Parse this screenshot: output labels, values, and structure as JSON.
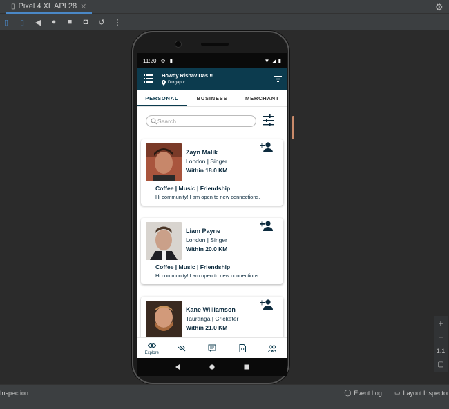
{
  "ide": {
    "device_tab": "Pixel 4 XL API 28",
    "close_glyph": "✕",
    "status_left": "Inspection",
    "status_right": [
      "Event Log",
      "Layout Inspector"
    ],
    "zoom": {
      "zoom_in": "+",
      "zoom_out": "−",
      "actual_size": "1:1"
    }
  },
  "phone": {
    "status": {
      "time": "11:20"
    },
    "app": {
      "greeting": "Howdy Rishav Das !!",
      "location": "Durgapur",
      "tabs": [
        "PERSONAL",
        "BUSINESS",
        "MERCHANT"
      ],
      "active_tab": "PERSONAL",
      "search_placeholder": "Search",
      "cards": [
        {
          "name": "Zayn Malik",
          "place": "London | Singer",
          "distance": "Within 18.0 KM",
          "interests": "Coffee | Music | Friendship",
          "bio": "Hi community! I am open to new connections."
        },
        {
          "name": "Liam Payne",
          "place": "London | Singer",
          "distance": "Within 20.0 KM",
          "interests": "Coffee | Music | Friendship",
          "bio": "Hi community! I am open to new connections."
        },
        {
          "name": "Kane Williamson",
          "place": "Tauranga | Cricketer",
          "distance": "Within 21.0 KM",
          "interests": "",
          "bio": ""
        }
      ],
      "bottom_nav": [
        {
          "icon": "eye-icon",
          "label": "Explore"
        },
        {
          "icon": "handshake-icon",
          "label": ""
        },
        {
          "icon": "chat-icon",
          "label": ""
        },
        {
          "icon": "document-icon",
          "label": ""
        },
        {
          "icon": "people-icon",
          "label": ""
        }
      ]
    }
  },
  "colors": {
    "primary": "#0c3b4e",
    "accent_text": "#0c2b3e",
    "ide_bg": "#2b2b2b"
  }
}
